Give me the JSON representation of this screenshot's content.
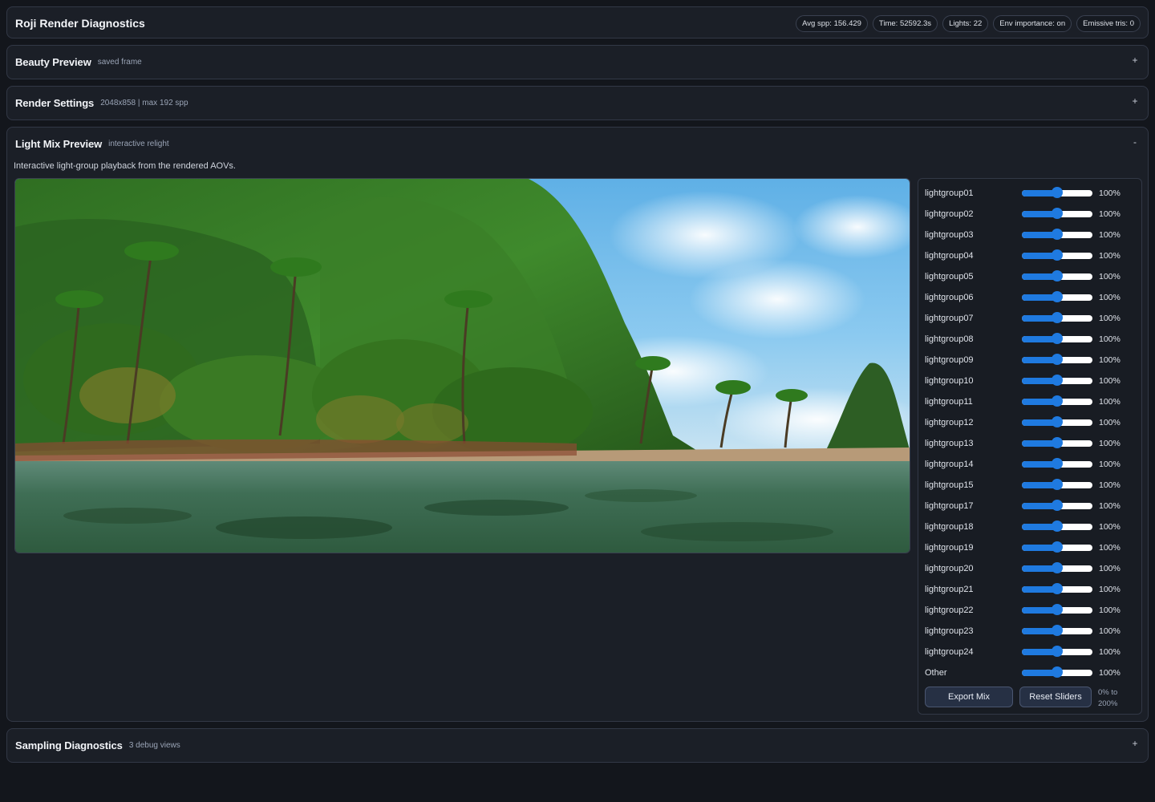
{
  "header": {
    "title": "Roji Render Diagnostics",
    "badges": [
      "Avg spp: 156.429",
      "Time: 52592.3s",
      "Lights: 22",
      "Env importance: on",
      "Emissive tris: 0"
    ]
  },
  "panels": {
    "beauty": {
      "title": "Beauty Preview",
      "subtitle": "saved frame",
      "toggle": "+"
    },
    "render": {
      "title": "Render Settings",
      "subtitle": "2048x858 | max 192 spp",
      "toggle": "+"
    },
    "lightmix": {
      "title": "Light Mix Preview",
      "subtitle": "interactive relight",
      "toggle": "-",
      "description": "Interactive light-group playback from the rendered AOVs."
    },
    "sampling": {
      "title": "Sampling Diagnostics",
      "subtitle": "3 debug views",
      "toggle": "+"
    }
  },
  "lightgroups": [
    {
      "label": "lightgroup01",
      "value": "100%",
      "level": 0.5
    },
    {
      "label": "lightgroup02",
      "value": "100%",
      "level": 0.5
    },
    {
      "label": "lightgroup03",
      "value": "100%",
      "level": 0.5
    },
    {
      "label": "lightgroup04",
      "value": "100%",
      "level": 0.5
    },
    {
      "label": "lightgroup05",
      "value": "100%",
      "level": 0.5
    },
    {
      "label": "lightgroup06",
      "value": "100%",
      "level": 0.5
    },
    {
      "label": "lightgroup07",
      "value": "100%",
      "level": 0.5
    },
    {
      "label": "lightgroup08",
      "value": "100%",
      "level": 0.5
    },
    {
      "label": "lightgroup09",
      "value": "100%",
      "level": 0.5
    },
    {
      "label": "lightgroup10",
      "value": "100%",
      "level": 0.5
    },
    {
      "label": "lightgroup11",
      "value": "100%",
      "level": 0.5
    },
    {
      "label": "lightgroup12",
      "value": "100%",
      "level": 0.5
    },
    {
      "label": "lightgroup13",
      "value": "100%",
      "level": 0.5
    },
    {
      "label": "lightgroup14",
      "value": "100%",
      "level": 0.5
    },
    {
      "label": "lightgroup15",
      "value": "100%",
      "level": 0.5
    },
    {
      "label": "lightgroup17",
      "value": "100%",
      "level": 0.5
    },
    {
      "label": "lightgroup18",
      "value": "100%",
      "level": 0.5
    },
    {
      "label": "lightgroup19",
      "value": "100%",
      "level": 0.5
    },
    {
      "label": "lightgroup20",
      "value": "100%",
      "level": 0.5
    },
    {
      "label": "lightgroup21",
      "value": "100%",
      "level": 0.5
    },
    {
      "label": "lightgroup22",
      "value": "100%",
      "level": 0.5
    },
    {
      "label": "lightgroup23",
      "value": "100%",
      "level": 0.5
    },
    {
      "label": "lightgroup24",
      "value": "100%",
      "level": 0.5
    },
    {
      "label": "Other",
      "value": "100%",
      "level": 0.5
    }
  ],
  "controls": {
    "export_label": "Export Mix",
    "reset_label": "Reset Sliders",
    "range_note": "0% to 200%"
  },
  "colors": {
    "accent": "#1f7ae0",
    "panel_bg": "#1b1f27",
    "page_bg": "#13161c"
  }
}
